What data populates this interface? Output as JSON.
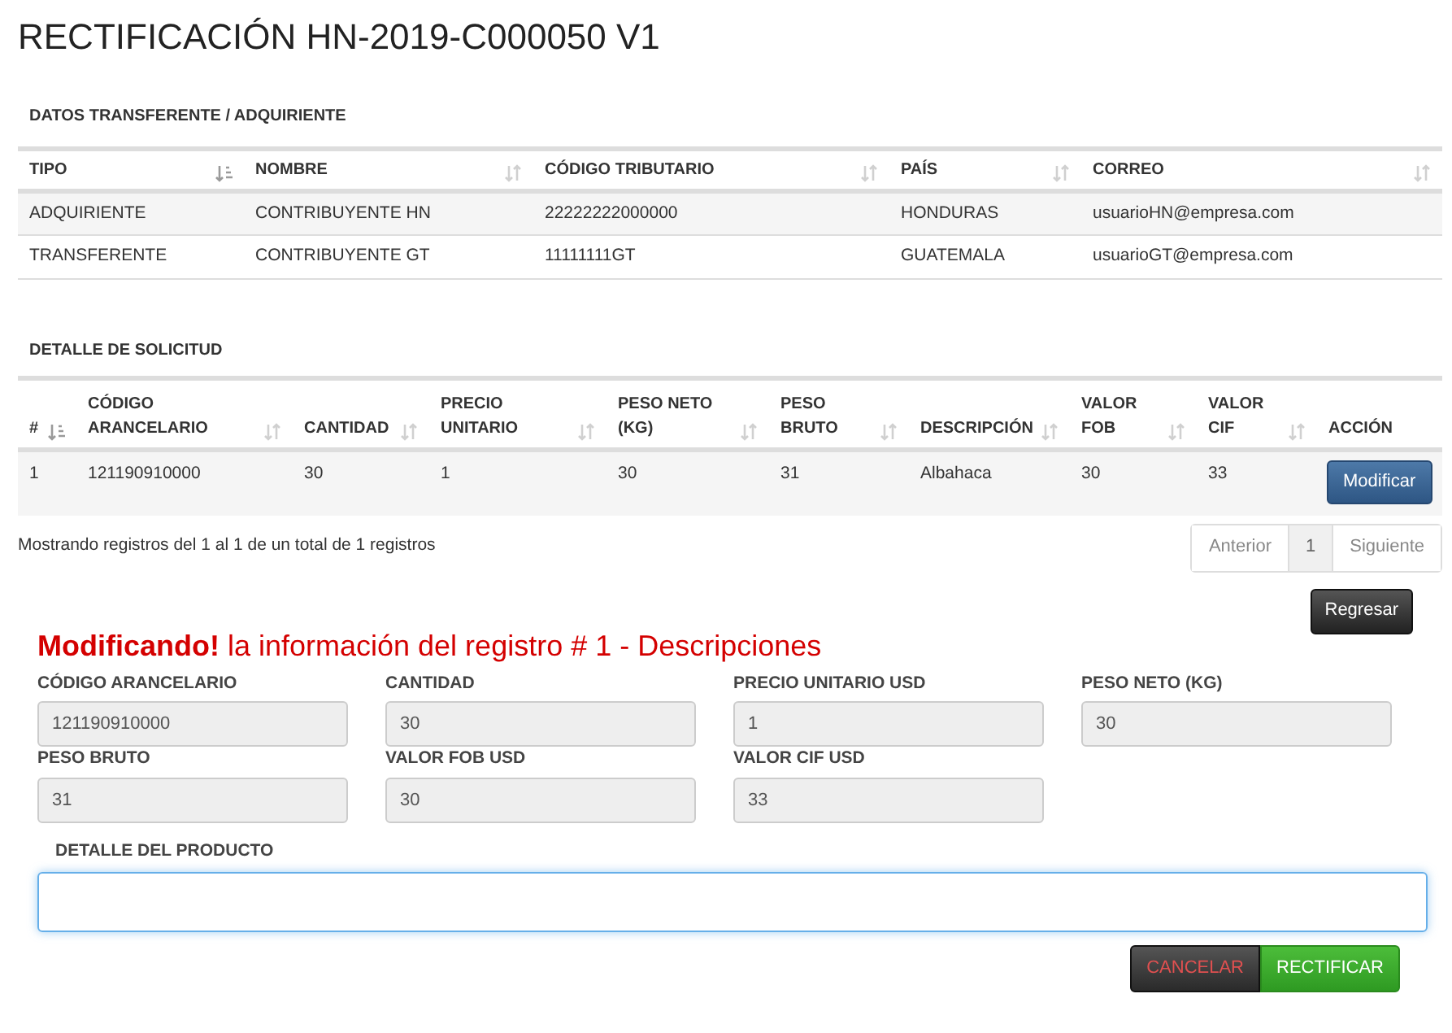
{
  "title": "RECTIFICACIÓN HN-2019-C000050 V1",
  "parties": {
    "heading": "DATOS TRANSFERENTE / ADQUIRIENTE",
    "columns": [
      {
        "label": "TIPO",
        "sorted": true
      },
      {
        "label": "NOMBRE",
        "sorted": false
      },
      {
        "label": "CÓDIGO TRIBUTARIO",
        "sorted": false
      },
      {
        "label": "PAÍS",
        "sorted": false
      },
      {
        "label": "CORREO",
        "sorted": false
      }
    ],
    "rows": [
      [
        "ADQUIRIENTE",
        "CONTRIBUYENTE HN",
        "22222222000000",
        "HONDURAS",
        "usuarioHN@empresa.com"
      ],
      [
        "TRANSFERENTE",
        "CONTRIBUYENTE GT",
        "11111111GT",
        "GUATEMALA",
        "usuarioGT@empresa.com"
      ]
    ]
  },
  "details": {
    "heading": "DETALLE DE SOLICITUD",
    "columns": [
      {
        "label": "#",
        "sorted": true
      },
      {
        "label": "CÓDIGO ARANCELARIO",
        "sorted": false
      },
      {
        "label": "CANTIDAD",
        "sorted": false
      },
      {
        "label": "PRECIO UNITARIO",
        "sorted": false
      },
      {
        "label": "PESO NETO (KG)",
        "sorted": false
      },
      {
        "label": "PESO BRUTO",
        "sorted": false
      },
      {
        "label": "DESCRIPCIÓN",
        "sorted": false
      },
      {
        "label": "VALOR FOB",
        "sorted": false
      },
      {
        "label": "VALOR CIF",
        "sorted": false
      },
      {
        "label": "ACCIÓN"
      }
    ],
    "rows": [
      {
        "cells": [
          "1",
          "121190910000",
          "30",
          "1",
          "30",
          "31",
          "Albahaca",
          "30",
          "33"
        ],
        "action": "Modificar"
      }
    ],
    "info": "Mostrando registros del 1 al 1 de un total de 1 registros",
    "pagination": [
      {
        "label": "Anterior",
        "selected": false
      },
      {
        "label": "1",
        "selected": true
      },
      {
        "label": "Siguiente",
        "selected": false
      }
    ]
  },
  "back_button": "Regresar",
  "edit": {
    "heading": "**Modificando!** la información del registro # 1 - Descripciones",
    "fields": [
      {
        "label": "CÓDIGO ARANCELARIO",
        "value": "121190910000"
      },
      {
        "label": "CANTIDAD",
        "value": "30"
      },
      {
        "label": "PRECIO UNITARIO USD",
        "value": "1"
      },
      {
        "label": "PESO NETO (KG)",
        "value": "30"
      },
      {
        "label": "PESO BRUTO",
        "value": "31"
      },
      {
        "label": "VALOR FOB USD",
        "value": "30"
      },
      {
        "label": "VALOR CIF USD",
        "value": "33"
      }
    ],
    "detail_label": "DETALLE DEL PRODUCTO",
    "cancel": "CANCELAR",
    "submit": "RECTIFICAR"
  }
}
